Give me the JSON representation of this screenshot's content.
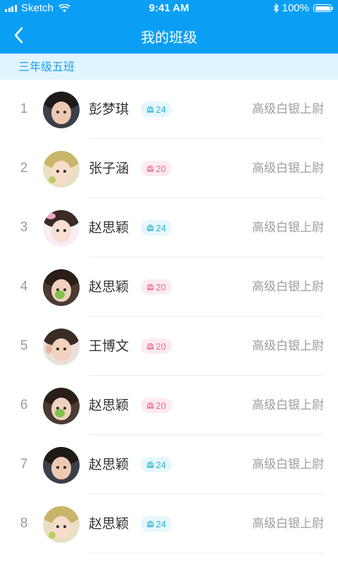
{
  "status_bar": {
    "carrier": "Sketch",
    "time": "9:41 AM",
    "battery_percent": "100%",
    "battery_level": 1.0
  },
  "nav": {
    "title": "我的班级",
    "back_icon": "chevron-left-icon"
  },
  "section": {
    "title": "三年级五班"
  },
  "students": [
    {
      "rank": "1",
      "name": "彭梦琪",
      "badge": "24",
      "badge_color": "cyan",
      "badge_icon": "helmet-icon",
      "title": "高级白银上尉",
      "avatar": "boy-dark-hair"
    },
    {
      "rank": "2",
      "name": "张子涵",
      "badge": "20",
      "badge_color": "pink",
      "badge_icon": "helmet-icon",
      "title": "高级白银上尉",
      "avatar": "girl-yellow-hat"
    },
    {
      "rank": "3",
      "name": "赵思颖",
      "badge": "24",
      "badge_color": "cyan",
      "badge_icon": "helmet-icon",
      "title": "高级白银上尉",
      "avatar": "girl-pink-bow"
    },
    {
      "rank": "4",
      "name": "赵思颖",
      "badge": "20",
      "badge_color": "pink",
      "badge_icon": "helmet-icon",
      "title": "高级白银上尉",
      "avatar": "girl-green-leaf"
    },
    {
      "rank": "5",
      "name": "王博文",
      "badge": "20",
      "badge_color": "pink",
      "badge_icon": "helmet-icon",
      "title": "高级白银上尉",
      "avatar": "boy-light-bg"
    },
    {
      "rank": "6",
      "name": "赵思颖",
      "badge": "20",
      "badge_color": "pink",
      "badge_icon": "helmet-icon",
      "title": "高级白银上尉",
      "avatar": "girl-green-leaf"
    },
    {
      "rank": "7",
      "name": "赵思颖",
      "badge": "24",
      "badge_color": "cyan",
      "badge_icon": "helmet-icon",
      "title": "高级白银上尉",
      "avatar": "boy-dark-hair"
    },
    {
      "rank": "8",
      "name": "赵思颖",
      "badge": "24",
      "badge_color": "cyan",
      "badge_icon": "helmet-icon",
      "title": "高级白银上尉",
      "avatar": "girl-yellow-hat"
    }
  ],
  "colors": {
    "primary": "#0a9ff5",
    "section_bg": "#e0f4fe",
    "section_text": "#1d9ef0",
    "badge_cyan": "#2eb4d9",
    "badge_pink": "#ec6a97"
  }
}
